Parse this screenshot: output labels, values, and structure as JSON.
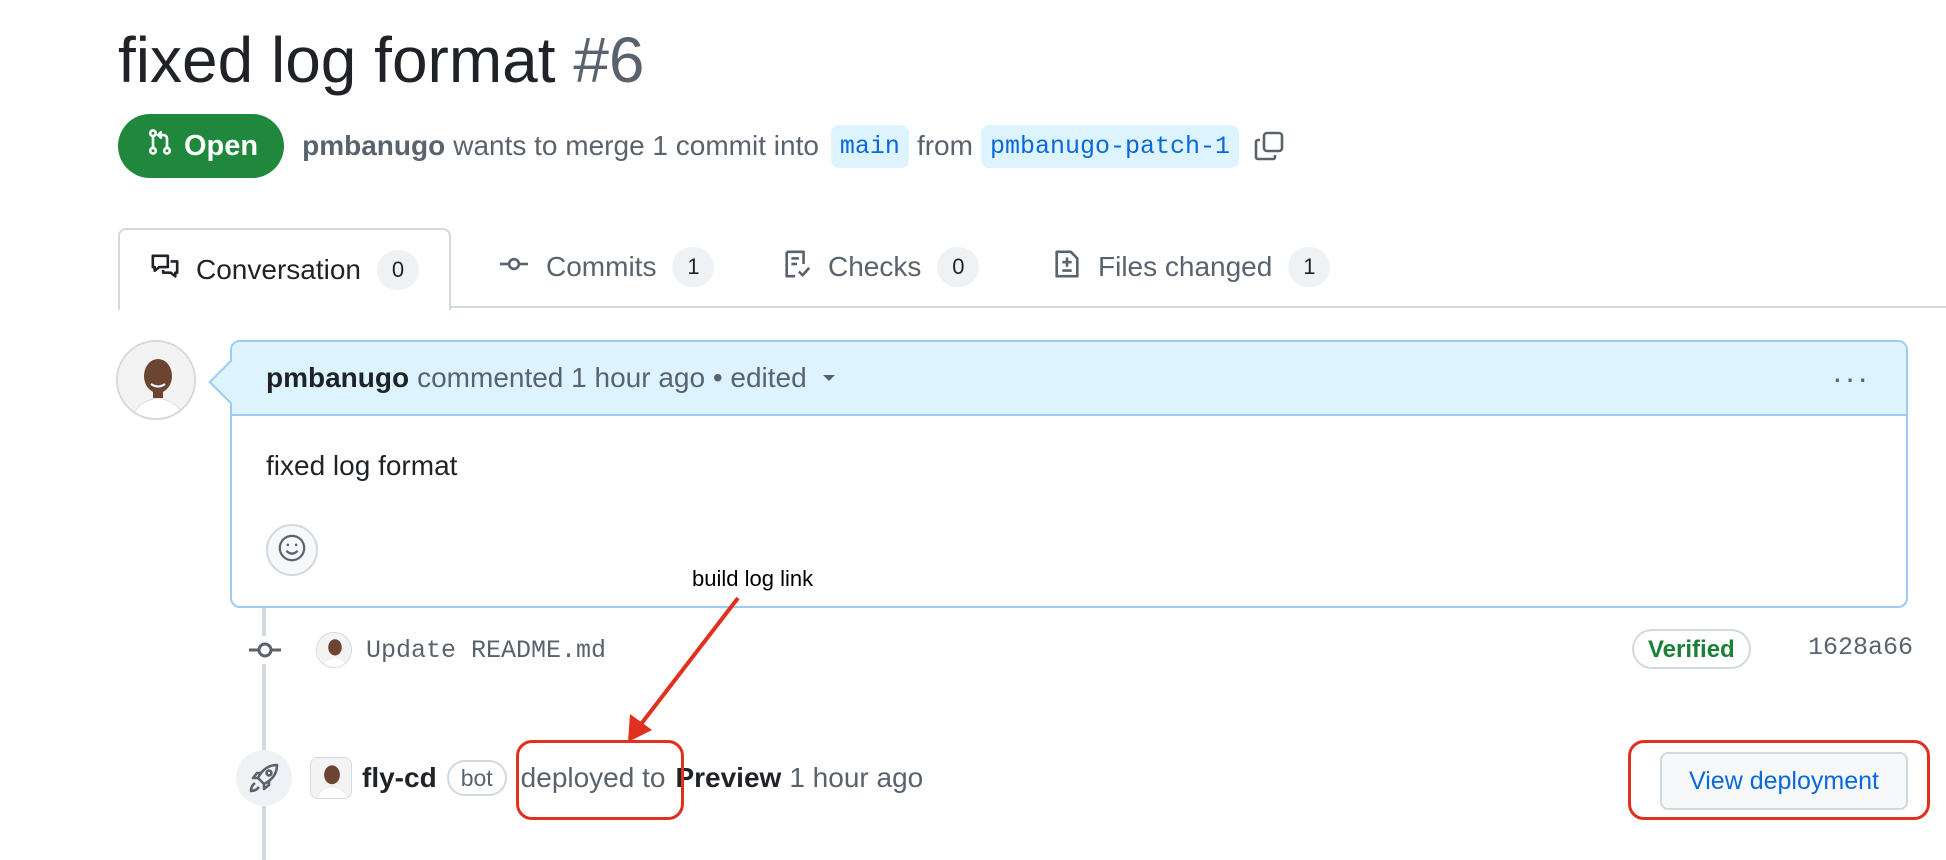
{
  "pr": {
    "title": "fixed log format",
    "number": "#6",
    "state": "Open",
    "author": "pmbanugo",
    "merge_text": "wants to merge 1 commit into",
    "base_branch": "main",
    "from_text": "from",
    "head_branch": "pmbanugo-patch-1"
  },
  "tabs": [
    {
      "label": "Conversation",
      "count": "0",
      "icon": "comment-discussion-icon",
      "active": true
    },
    {
      "label": "Commits",
      "count": "1",
      "icon": "git-commit-icon"
    },
    {
      "label": "Checks",
      "count": "0",
      "icon": "checklist-icon"
    },
    {
      "label": "Files changed",
      "count": "1",
      "icon": "file-diff-icon"
    }
  ],
  "comment": {
    "author": "pmbanugo",
    "meta": "commented 1 hour ago • edited",
    "body": "fixed log format",
    "menu": "···"
  },
  "commit": {
    "message": "Update README.md",
    "badge": "Verified",
    "sha": "1628a66"
  },
  "deployment": {
    "actor": "fly-cd",
    "badge": "bot",
    "action": "deployed to",
    "environment": "Preview",
    "time": "1 hour ago",
    "button": "View deployment"
  },
  "annotation": {
    "label": "build log link",
    "color": "#e0301e"
  },
  "colors": {
    "open_green": "#1f883d",
    "link_blue": "#0969da",
    "header_blue": "#ddf4ff",
    "verified_green": "#1a7f37"
  }
}
